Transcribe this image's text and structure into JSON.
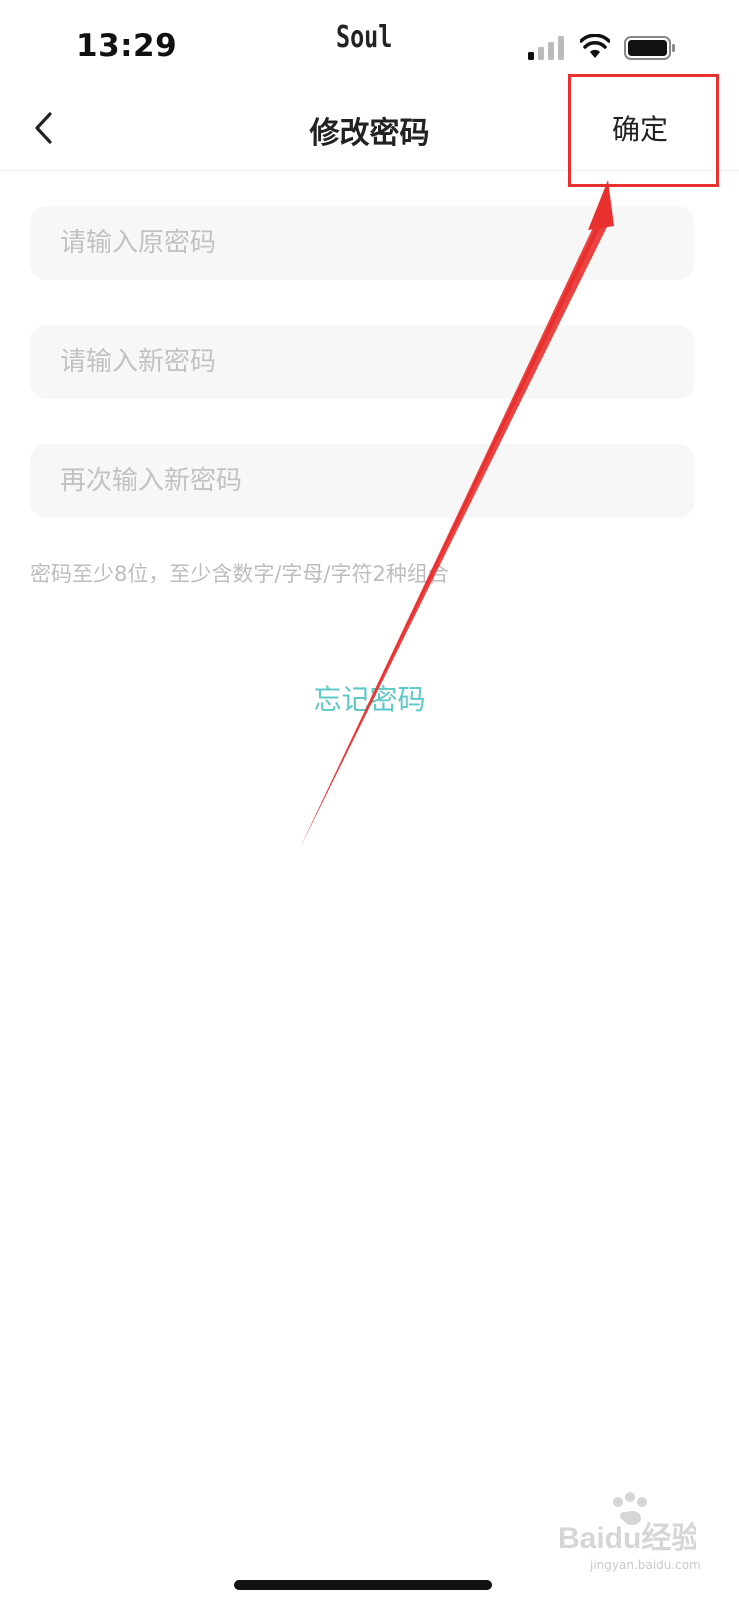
{
  "status_bar": {
    "time": "13:29",
    "app_name": "Soul"
  },
  "nav": {
    "title": "修改密码",
    "confirm_label": "确定",
    "back_icon": "chevron-left-icon"
  },
  "form": {
    "old_password_placeholder": "请输入原密码",
    "new_password_placeholder": "请输入新密码",
    "confirm_password_placeholder": "再次输入新密码",
    "hint": "密码至少8位，至少含数字/字母/字符2种组合"
  },
  "forgot_password_label": "忘记密码",
  "watermark": {
    "brand": "Baidu经验",
    "url": "jingyan.baidu.com"
  },
  "colors": {
    "accent": "#5cc9c6",
    "annotation": "#e8302e",
    "field_background": "#f7f7f7"
  }
}
